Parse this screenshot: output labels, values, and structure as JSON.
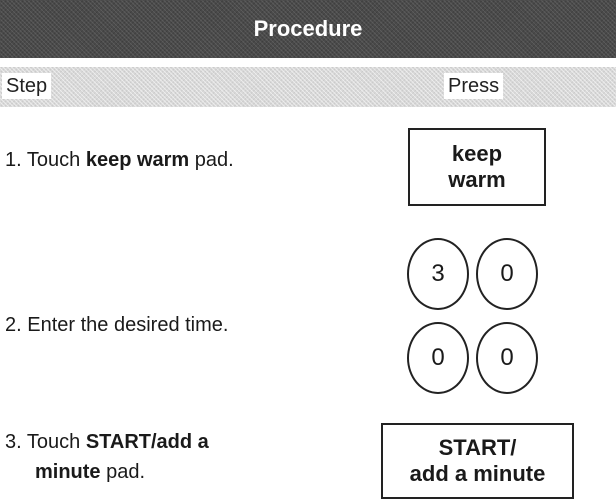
{
  "header": {
    "title": "Procedure"
  },
  "columns": {
    "step_label": "Step",
    "press_label": "Press"
  },
  "steps": [
    {
      "number": "1.",
      "text_before": "Touch ",
      "bold": "keep warm",
      "text_after": " pad."
    },
    {
      "number": "2.",
      "text": "Enter the desired time."
    },
    {
      "number": "3.",
      "text_before": "Touch ",
      "bold_line1": "START/add a",
      "bold_line2": "minute",
      "text_after": " pad."
    }
  ],
  "keys": {
    "keep_warm_line1": "keep",
    "keep_warm_line2": "warm",
    "digits": [
      "3",
      "0",
      "0",
      "0"
    ],
    "start_line1": "START/",
    "start_line2": "add a minute"
  }
}
